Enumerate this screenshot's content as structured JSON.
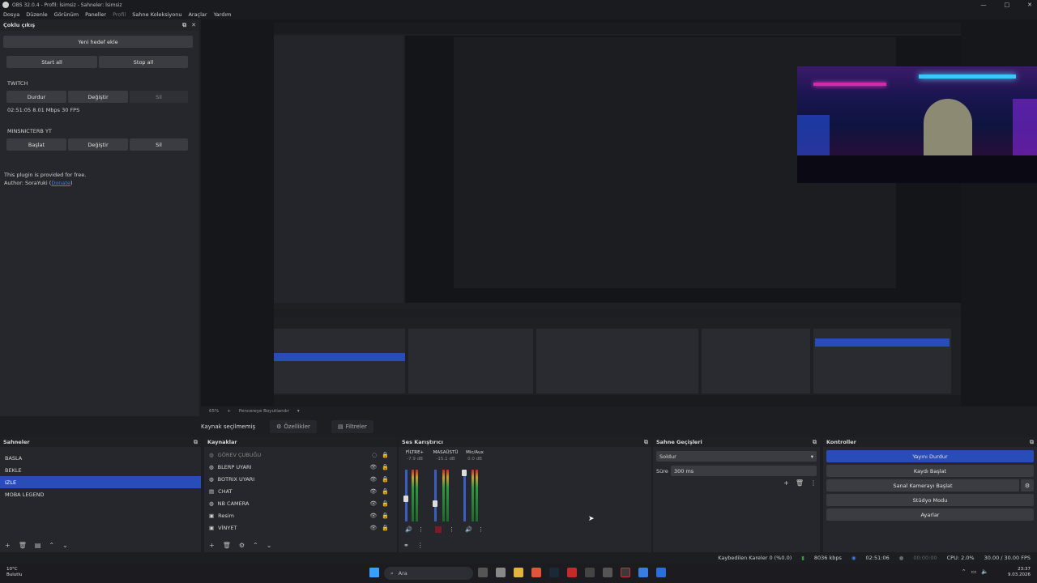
{
  "window": {
    "title": "OBS 32.0.4 - Profil: İsimsiz - Sahneler: İsimsiz",
    "min": "—",
    "max": "□",
    "close": "✕"
  },
  "menu": [
    "Dosya",
    "Düzenle",
    "Görünüm",
    "Paneller",
    "Profil",
    "Sahne Koleksiyonu",
    "Araçlar",
    "Yardım"
  ],
  "multi_output": {
    "title": "Çoklu çıkış",
    "add_target": "Yeni hedef ekle",
    "start_all": "Start all",
    "stop_all": "Stop all",
    "targets": [
      {
        "name": "TWITCH",
        "btn1": "Durdur",
        "btn2": "Değiştir",
        "btn3": "Sil",
        "stats": "02:51:05  8.01 Mbps  30 FPS"
      },
      {
        "name": "MINSNICTERB YT",
        "btn1": "Başlat",
        "btn2": "Değiştir",
        "btn3": "Sil"
      }
    ],
    "note1": "This plugin is provided for free.",
    "note2_prefix": "Author: SoraYuki (",
    "note2_link": "Donate",
    "note2_suffix": ")"
  },
  "preview_bar": {
    "zoom": "65%",
    "resize": "Pencereye Boyutlandır"
  },
  "context": {
    "no_source": "Kaynak seçilmemiş",
    "properties": "Özellikler",
    "filters": "Filtreler"
  },
  "scenes": {
    "title": "Sahneler",
    "items": [
      "BASLA",
      "BEKLE",
      "IZLE",
      "MOBA LEGEND"
    ],
    "selected_index": 2
  },
  "sources": {
    "title": "Kaynaklar",
    "items": [
      "GÖREV ÇUBUĞU",
      "BLERP UYARI",
      "BOTRIX UYARI",
      "CHAT",
      "NB CAMERA",
      "Resim",
      "VİNYET"
    ]
  },
  "mixer": {
    "title": "Ses Karıştırıcı",
    "channels": [
      {
        "name": "FİLTRE+",
        "db": "-7.9 dB"
      },
      {
        "name": "MASAÜSTÜ",
        "db": "-15.1 dB"
      },
      {
        "name": "Mic/Aux",
        "db": "0.0 dB"
      }
    ]
  },
  "transitions": {
    "title": "Sahne Geçişleri",
    "type": "Soldur",
    "duration_label": "Süre",
    "duration": "300 ms"
  },
  "controls": {
    "title": "Kontroller",
    "buttons": [
      "Yayını Durdur",
      "Kaydı Başlat",
      "Sanal Kamerayı Başlat",
      "Stüdyo Modu",
      "Ayarlar"
    ]
  },
  "status": {
    "dropped": "Kaybedilen Kareler 0 (%0.0)",
    "bitrate": "8036 kbps",
    "stream_time": "02:51:06",
    "rec_time": "00:00:00",
    "cpu": "CPU: 2.0%",
    "fps": "30.00 / 30.00 FPS"
  },
  "taskbar": {
    "temp": "10°C",
    "weather": "Bulutlu",
    "search": "Ara",
    "time": "23:37",
    "date": "9.03.2026"
  },
  "colors": {
    "accent": "#284cb8",
    "panel": "#26272c",
    "bg": "#1d1e22"
  }
}
